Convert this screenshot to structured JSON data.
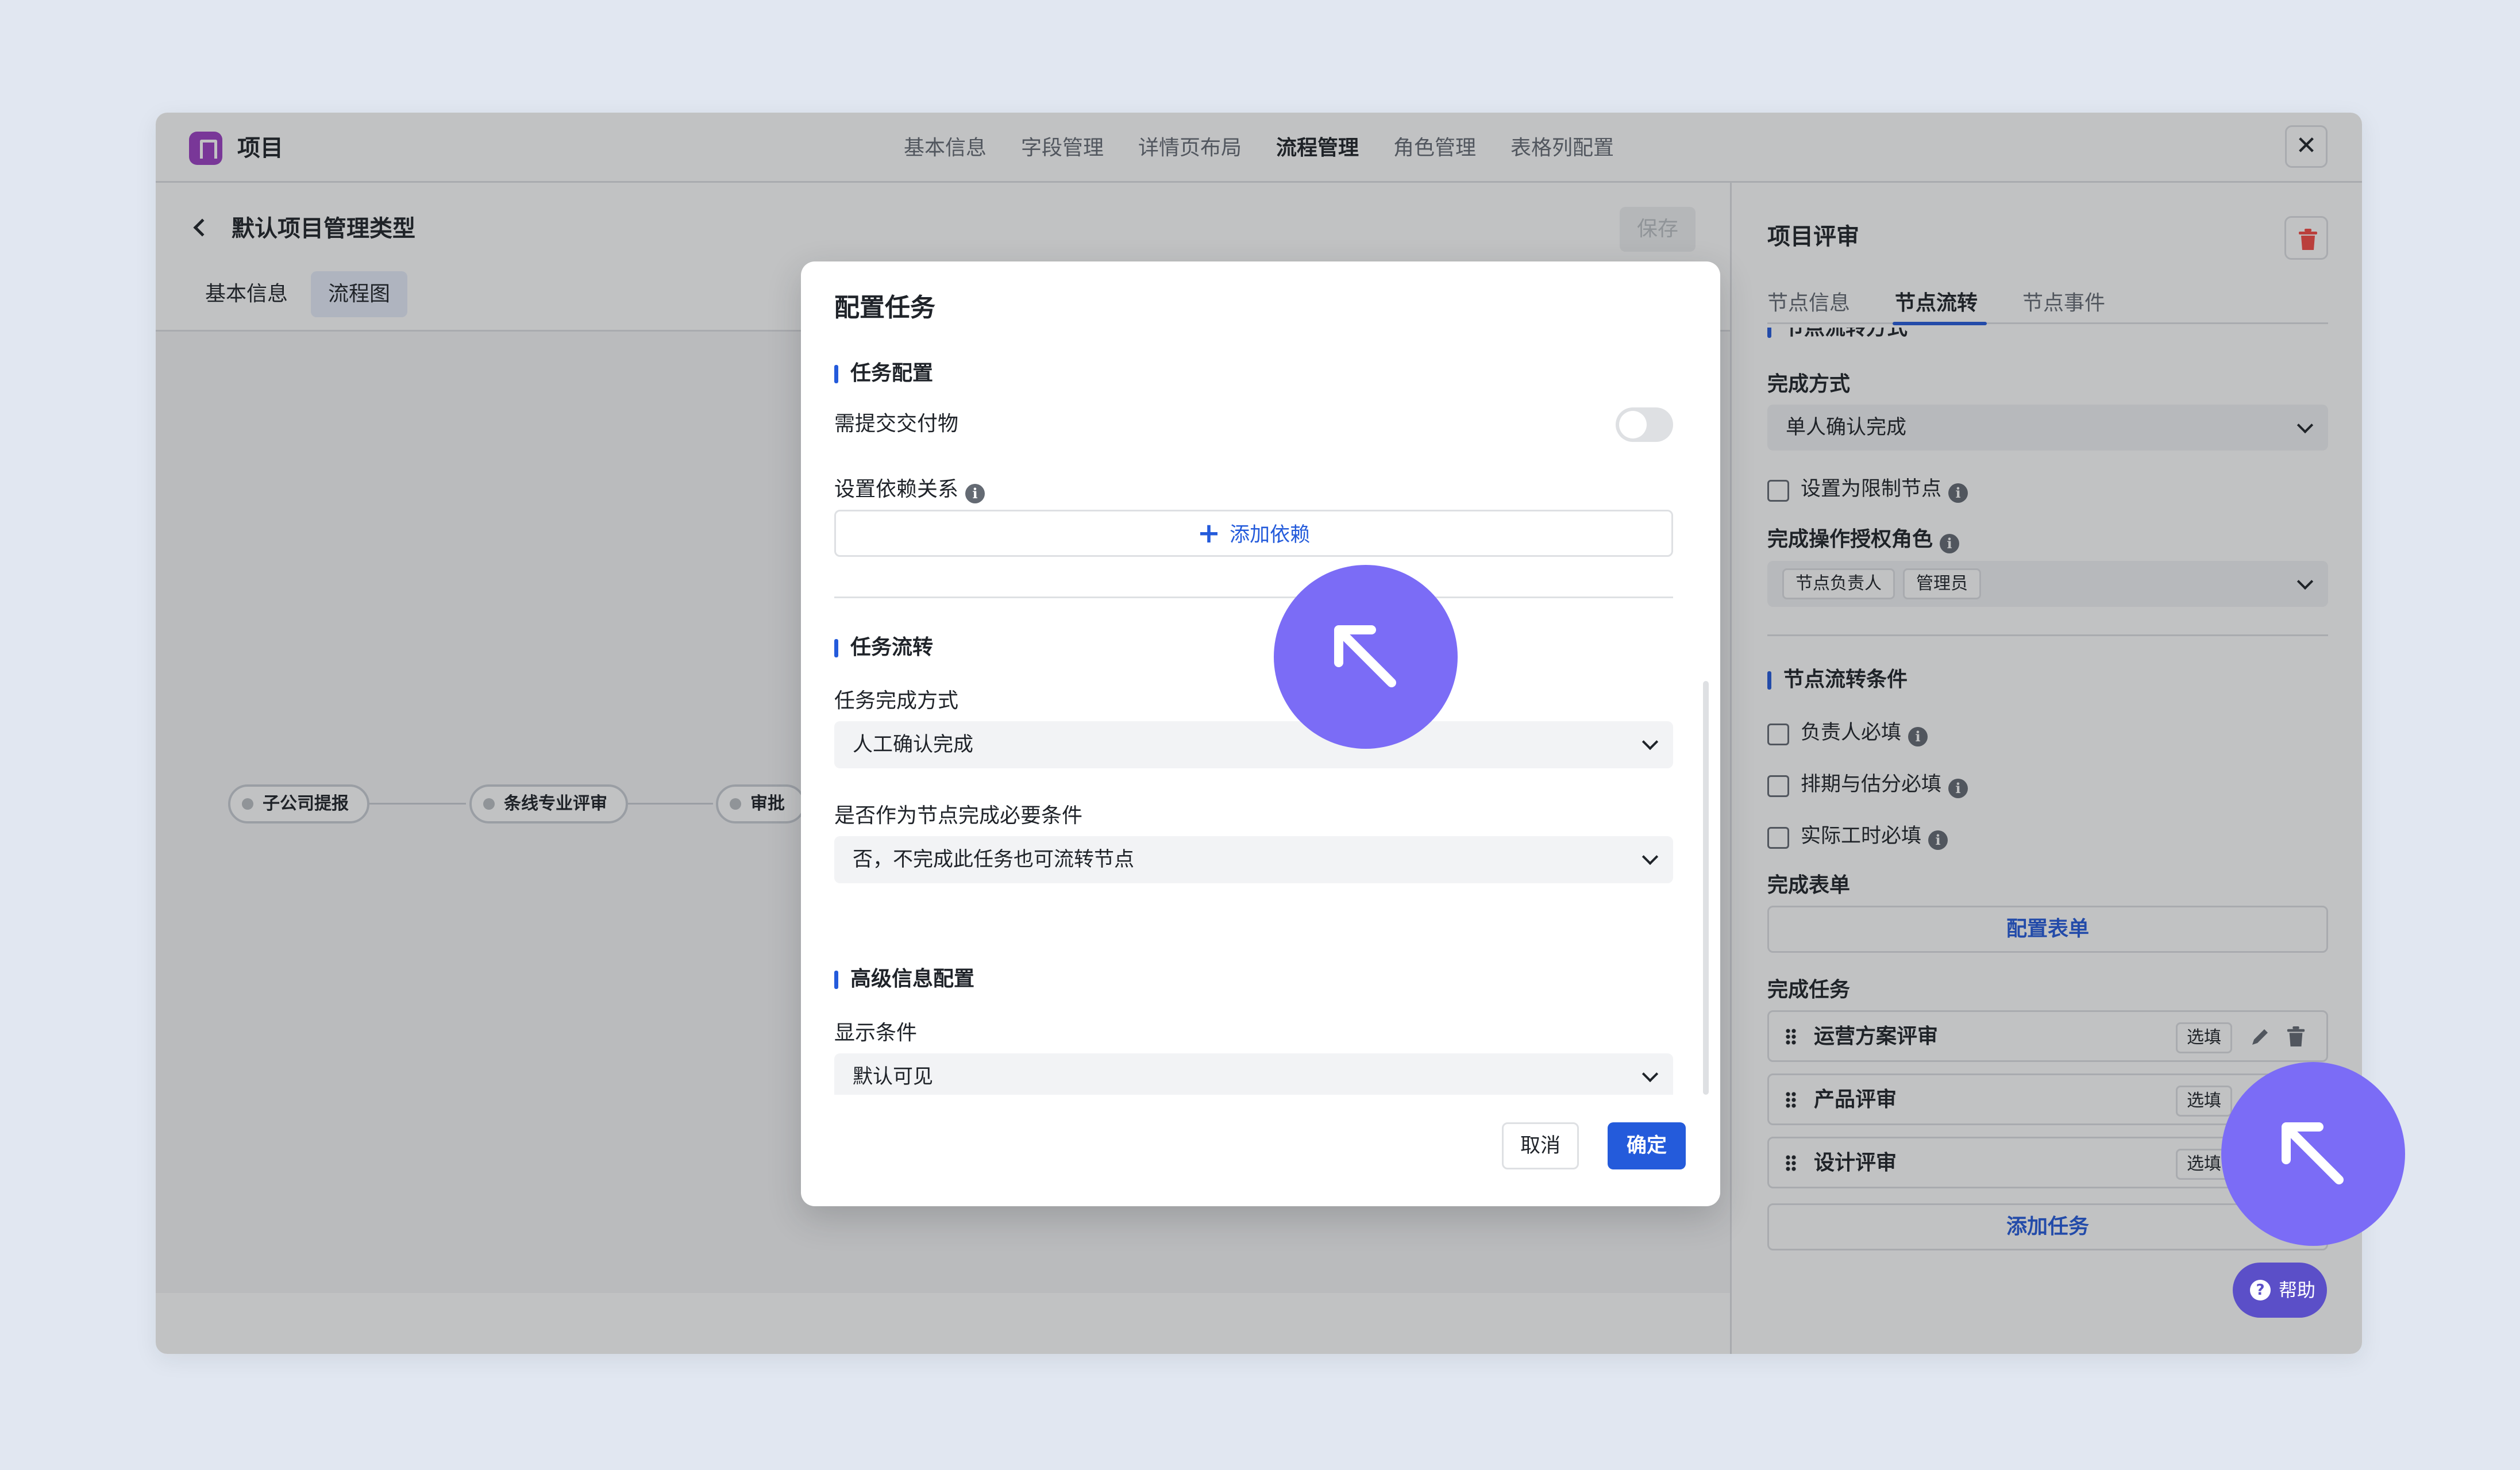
{
  "app": {
    "title": "项目",
    "close_label": "✕"
  },
  "topnav": {
    "tabs": [
      "基本信息",
      "字段管理",
      "详情页布局",
      "流程管理",
      "角色管理",
      "表格列配置"
    ],
    "active_index": 3
  },
  "left": {
    "page_title": "默认项目管理类型",
    "save_label": "保存",
    "subtabs": [
      "基本信息",
      "流程图"
    ],
    "active_subtab": 1,
    "flow_nodes": [
      "子公司提报",
      "条线专业评审",
      "审批"
    ]
  },
  "right_panel": {
    "title": "项目评审",
    "tabs": [
      "节点信息",
      "节点流转",
      "节点事件"
    ],
    "active_tab": 1,
    "cut_section": "节点流转方式",
    "complete_mode_label": "完成方式",
    "complete_mode_value": "单人确认完成",
    "restrict_node_label": "设置为限制节点",
    "auth_role_label": "完成操作授权角色",
    "auth_roles": [
      "节点负责人",
      "管理员"
    ],
    "conditions_section": "节点流转条件",
    "conditions": [
      "负责人必填",
      "排期与估分必填",
      "实际工时必填"
    ],
    "form_label": "完成表单",
    "form_button": "配置表单",
    "tasks_label": "完成任务",
    "tasks": [
      {
        "name": "运营方案评审",
        "tag": "选填"
      },
      {
        "name": "产品评审",
        "tag": "选填"
      },
      {
        "name": "设计评审",
        "tag": "选填"
      }
    ],
    "add_task_button": "添加任务"
  },
  "modal": {
    "title": "配置任务",
    "task_config_section": "任务配置",
    "deliverable_label": "需提交交付物",
    "deliverable_enabled": false,
    "dependency_label": "设置依赖关系",
    "add_dependency": "添加依赖",
    "task_flow_section": "任务流转",
    "completion_mode_label": "任务完成方式",
    "completion_mode_value": "人工确认完成",
    "required_label": "是否作为节点完成必要条件",
    "required_value": "否，不完成此任务也可流转节点",
    "advanced_section": "高级信息配置",
    "display_condition_label": "显示条件",
    "display_condition_value": "默认可见",
    "cancel": "取消",
    "confirm": "确定"
  },
  "help": {
    "label": "帮助"
  },
  "colors": {
    "primary": "#245bdb",
    "cursor": "#7b6cf6",
    "logo": "#9b3fc4",
    "danger": "#f54a45"
  }
}
